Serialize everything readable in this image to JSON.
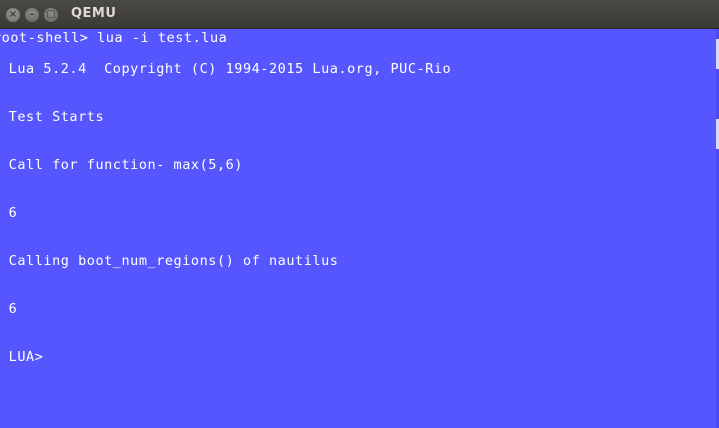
{
  "window": {
    "title": "QEMU",
    "close_glyph": "×",
    "minimize_glyph": "–",
    "maximize_glyph": "▢"
  },
  "screen": {
    "background_color": "#5656fe",
    "text_color": "#ffffff",
    "lines": [
      "root-shell> lua -i test.lua",
      " Lua 5.2.4  Copyright (C) 1994-2015 Lua.org, PUC-Rio",
      " Test Starts",
      " Call for function- max(5,6)",
      " 6",
      " Calling boot_num_regions() of nautilus",
      " 6",
      " LUA>"
    ]
  }
}
